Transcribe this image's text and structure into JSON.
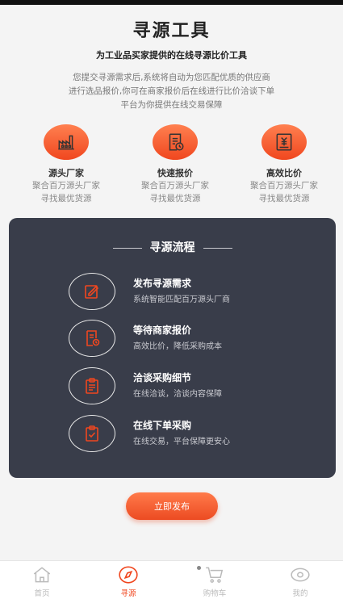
{
  "header": {
    "title": "寻源工具",
    "subtitle": "为工业品买家提供的在线寻源比价工具",
    "description": [
      "您提交寻源需求后,系统将自动为您匹配优质的供应商",
      "进行选品报价,你可在商家报价后在线进行比价洽谈下单",
      "平台为你提供在线交易保障"
    ]
  },
  "features": [
    {
      "icon": "factory-icon",
      "title": "源头厂家",
      "line1": "聚合百万源头厂家",
      "line2": "寻找最优货源"
    },
    {
      "icon": "quote-icon",
      "title": "快速报价",
      "line1": "聚合百万源头厂家",
      "line2": "寻找最优货源"
    },
    {
      "icon": "price-compare-icon",
      "title": "高效比价",
      "line1": "聚合百万源头厂家",
      "line2": "寻找最优货源"
    }
  ],
  "process": {
    "title": "寻源流程",
    "steps": [
      {
        "icon": "edit-icon",
        "title": "发布寻源需求",
        "subtitle": "系统智能匹配百万源头厂商"
      },
      {
        "icon": "document-clock-icon",
        "title": "等待商家报价",
        "subtitle": "高效比价，降低采购成本"
      },
      {
        "icon": "clipboard-icon",
        "title": "洽谈采购细节",
        "subtitle": "在线洽谈，洽谈内容保障"
      },
      {
        "icon": "clipboard-check-icon",
        "title": "在线下单采购",
        "subtitle": "在线交易，平台保障更安心"
      }
    ]
  },
  "action": {
    "publish_label": "立即发布"
  },
  "tabbar": {
    "items": [
      {
        "label": "首页",
        "icon": "home-icon",
        "active": false
      },
      {
        "label": "寻源",
        "icon": "compass-icon",
        "active": true
      },
      {
        "label": "购物车",
        "icon": "cart-icon",
        "active": false
      },
      {
        "label": "我的",
        "icon": "user-eye-icon",
        "active": false
      }
    ]
  },
  "colors": {
    "accent": "#f0471f",
    "panel": "#393d4a",
    "background": "#f4f4f4"
  }
}
